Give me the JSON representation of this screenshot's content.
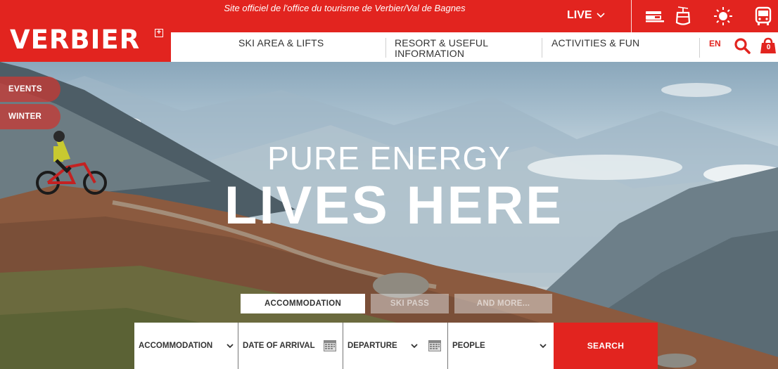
{
  "topbar": {
    "tagline": "Site officiel de l'office du tourisme de Verbier/Val de Bagnes",
    "live_label": "LIVE",
    "icons": [
      "webcam-icon",
      "cable-car-icon",
      "weather-sun-icon",
      "bus-icon"
    ]
  },
  "logo": {
    "text": "VERBIER",
    "mark": "+"
  },
  "nav": {
    "items": [
      {
        "label": "SKI AREA & LIFTS"
      },
      {
        "label": "RESORT & USEFUL INFORMATION"
      },
      {
        "label": "ACTIVITIES & FUN"
      }
    ],
    "language": "EN",
    "cart_count": "0"
  },
  "side_tabs": [
    {
      "label": "EVENTS"
    },
    {
      "label": "WINTER"
    }
  ],
  "hero": {
    "line1": "PURE ENERGY",
    "line2": "LIVES HERE"
  },
  "booking": {
    "tabs": [
      {
        "label": "ACCOMMODATION",
        "active": true
      },
      {
        "label": "SKI PASS",
        "active": false
      },
      {
        "label": "AND MORE...",
        "active": false
      }
    ],
    "fields": {
      "accommodation": "ACCOMMODATION",
      "arrival": "DATE OF ARRIVAL",
      "departure": "DEPARTURE",
      "people": "PEOPLE"
    },
    "search_label": "SEARCH"
  },
  "colors": {
    "brand_red": "#e2241f"
  }
}
